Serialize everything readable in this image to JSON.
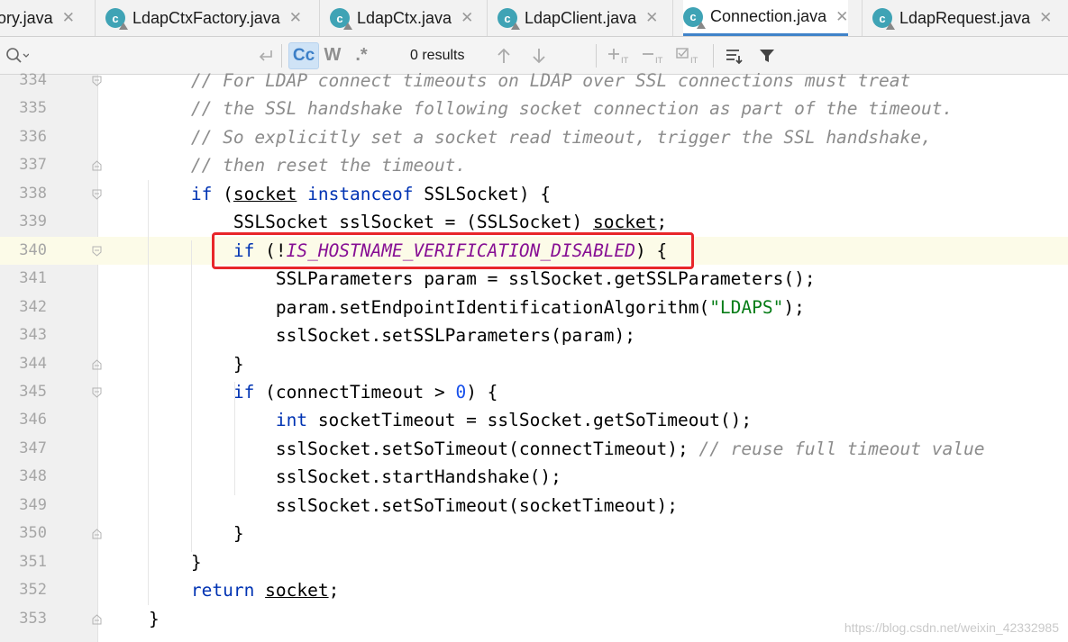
{
  "tabs": [
    {
      "label": "tory.java",
      "icon": "class-icon",
      "active": false
    },
    {
      "label": "LdapCtxFactory.java",
      "icon": "class-icon",
      "active": false
    },
    {
      "label": "LdapCtx.java",
      "icon": "class-icon",
      "active": false
    },
    {
      "label": "LdapClient.java",
      "icon": "class-icon",
      "active": false
    },
    {
      "label": "Connection.java",
      "icon": "class-icon",
      "active": true
    },
    {
      "label": "LdapRequest.java",
      "icon": "class-icon",
      "active": false
    }
  ],
  "tab_icon_letter": "c",
  "find_bar": {
    "search_value": "",
    "match_case_label": "Cc",
    "words_label": "W",
    "regex_label": ".*",
    "results": "0 results"
  },
  "lines": [
    {
      "num": "334",
      "code": "        // For LDAP connect timeouts on LDAP over SSL connections must treat"
    },
    {
      "num": "335",
      "code": "        // the SSL handshake following socket connection as part of the timeout."
    },
    {
      "num": "336",
      "code": "        // So explicitly set a socket read timeout, trigger the SSL handshake,"
    },
    {
      "num": "337",
      "code": "        // then reset the timeout."
    },
    {
      "num": "338",
      "code": "        if (socket instanceof SSLSocket) {"
    },
    {
      "num": "339",
      "code": "            SSLSocket sslSocket = (SSLSocket) socket;"
    },
    {
      "num": "340",
      "code": "            if (!IS_HOSTNAME_VERIFICATION_DISABLED) {"
    },
    {
      "num": "341",
      "code": "                SSLParameters param = sslSocket.getSSLParameters();"
    },
    {
      "num": "342",
      "code": "                param.setEndpointIdentificationAlgorithm(\"LDAPS\");"
    },
    {
      "num": "343",
      "code": "                sslSocket.setSSLParameters(param);"
    },
    {
      "num": "344",
      "code": "            }"
    },
    {
      "num": "345",
      "code": "            if (connectTimeout > 0) {"
    },
    {
      "num": "346",
      "code": "                int socketTimeout = sslSocket.getSoTimeout();"
    },
    {
      "num": "347",
      "code": "                sslSocket.setSoTimeout(connectTimeout); // reuse full timeout value"
    },
    {
      "num": "348",
      "code": "                sslSocket.startHandshake();"
    },
    {
      "num": "349",
      "code": "                sslSocket.setSoTimeout(socketTimeout);"
    },
    {
      "num": "350",
      "code": "            }"
    },
    {
      "num": "351",
      "code": "        }"
    },
    {
      "num": "352",
      "code": "        return socket;"
    },
    {
      "num": "353",
      "code": "    }"
    }
  ],
  "current_line": "340",
  "watermark": "https://blog.csdn.net/weixin_42332985",
  "colors": {
    "keyword": "#0033b3",
    "comment": "#8c8c8c",
    "string": "#067d17",
    "number": "#1750eb",
    "constant": "#871094",
    "highlight_box": "#e8262a",
    "active_tab": "#4083c9"
  }
}
